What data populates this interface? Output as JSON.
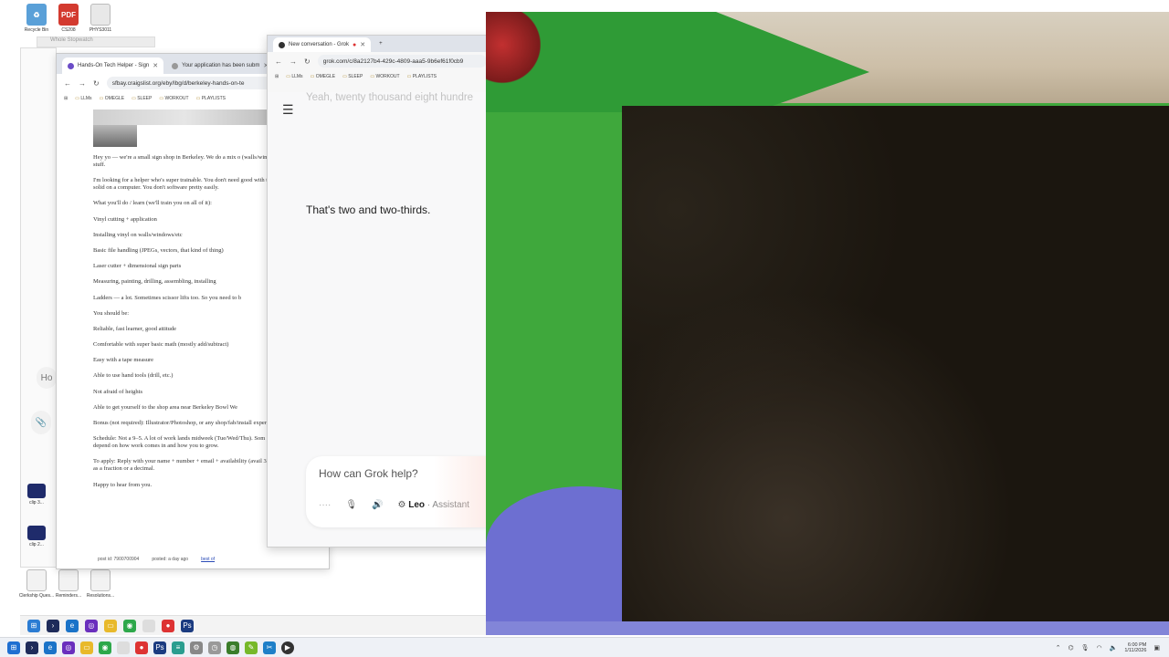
{
  "desktop": {
    "icons": [
      {
        "name": "recycle-bin-desktop-icon",
        "label": "Recycle Bin",
        "glyph": "♻",
        "color": "#5aa0d8"
      },
      {
        "name": "pdf-desktop-icon",
        "label": "CS208",
        "glyph": "PDF",
        "color": "#d33a2f"
      },
      {
        "name": "file-desktop-icon",
        "label": "PHYS3011",
        "glyph": "",
        "color": "#e8e8e8"
      }
    ],
    "lower_icons": [
      {
        "name": "video-file-icon-1",
        "label": "clip 3...",
        "color": "#1f2b6b"
      },
      {
        "name": "video-file-icon-2",
        "label": "clip 2...",
        "color": "#1f2b6b"
      }
    ],
    "bottom_icons": [
      {
        "name": "doc-desktop-icon-1",
        "label": "Clerkship Ques..."
      },
      {
        "name": "doc-desktop-icon-2",
        "label": "Reminders..."
      },
      {
        "name": "doc-desktop-icon-3",
        "label": "Resolutions..."
      }
    ],
    "stopwatch_title": "Whole Stopwatch",
    "side_stub_label": "Ho"
  },
  "craigslist_browser": {
    "tabs": [
      {
        "label": "Hands-On Tech Helper - Sign"
      },
      {
        "label": "Your application has been subm"
      }
    ],
    "url": "sfbay.craigslist.org/eby/lbg/d/berkeley-hands-on-te",
    "bookmarks": [
      "LLMs",
      "OMEGLE",
      "SLEEP",
      "WORKOUT",
      "PLAYLISTS"
    ],
    "paragraphs": [
      "Hey yo — we're a small sign shop in Berkeley. We do a mix o (walls/windows), and laser cut stuff.",
      "I'm looking for a helper who's super trainable. You don't need good with tools fast and who's solid on a computer. You don't software pretty easily.",
      "What you'll do / learn (we'll train you on all of it):",
      "Vinyl cutting + application",
      "Installing vinyl on walls/windows/etc",
      "Basic file handling (JPEGs, vectors, that kind of thing)",
      "Laser cutter + dimensional sign parts",
      "Measuring, painting, drilling, assembling, installing",
      "Ladders — a lot. Sometimes scissor lifts too. So you need to b",
      "You should be:",
      "Reliable, fast learner, good attitude",
      "Comfortable with super basic math (mostly add/subtract)",
      "Easy with a tape measure",
      "Able to use hand tools (drill, etc.)",
      "Not afraid of heights",
      "Able to get yourself to the shop area near Berkeley Bowl We",
      "Bonus (not required): Illustrator/Photoshop, or any shop/fab/install experience.",
      "Schedule: Not a 9–5. A lot of work lands midweek (Tue/Wed/Thu). Som premium. Hours depend on how work comes in and how you to grow.",
      "To apply: Reply with your name + number + email + availability (avail 3/8 + 1/16 = ? Send it as a fraction or a decimal.",
      "Happy to hear from you."
    ],
    "footer": {
      "post_id": "post id: 7900700904",
      "posted": "posted: a day ago",
      "link": "best of"
    }
  },
  "grok_browser": {
    "tab_label": "New conversation - Grok",
    "url": "grok.com/c/8a2127b4-429c-4809-aaa5-9b6ef61f0cb9",
    "bookmarks": [
      "LLMs",
      "OMEGLE",
      "SLEEP",
      "WORKOUT",
      "PLAYLISTS"
    ],
    "ghost_text": "Yeah, twenty thousand eight hundre",
    "answer": "That's two and two-thirds.",
    "input_placeholder": "How can Grok help?",
    "voice_name": "Leo",
    "voice_mode": "· Assistant"
  },
  "taskbar": {
    "clock_time": "6:00 PM",
    "clock_date": "1/11/2026"
  }
}
